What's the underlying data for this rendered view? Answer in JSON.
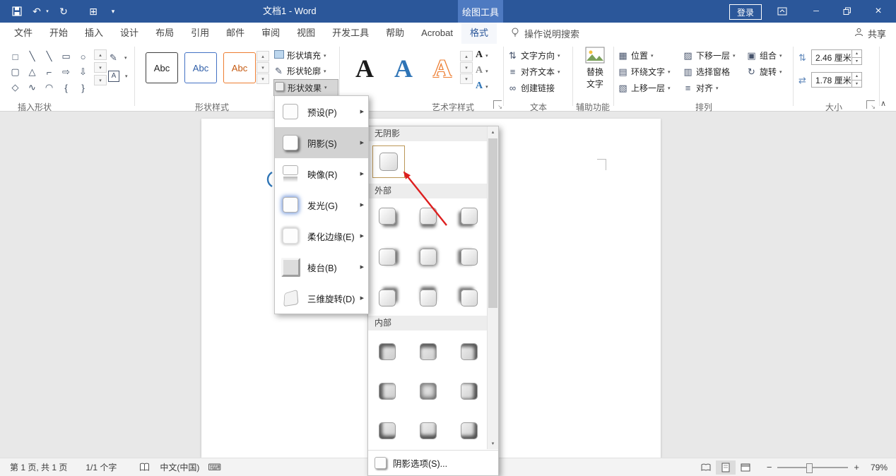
{
  "titlebar": {
    "title": "文档1 - Word",
    "context_tab": "绘图工具",
    "sign_in": "登录"
  },
  "ribbon_tabs": [
    "文件",
    "开始",
    "插入",
    "设计",
    "布局",
    "引用",
    "邮件",
    "审阅",
    "视图",
    "开发工具",
    "帮助",
    "Acrobat",
    "格式"
  ],
  "tellme_label": "操作说明搜索",
  "share_label": "共享",
  "group_labels": {
    "insert_shapes": "插入形状",
    "shape_styles": "形状样式",
    "wordart": "艺术字样式",
    "text": "文本",
    "accessibility": "辅助功能",
    "arrange": "排列",
    "size": "大小"
  },
  "insert_shapes": {
    "shapes": [
      "□",
      "╲",
      "╲",
      "▭",
      "○",
      "▢",
      "△",
      "⌐",
      "⇨",
      "⇩",
      "◇",
      "∿",
      "◠",
      "{",
      "}"
    ],
    "edit_shape": "✎",
    "textbox_letter": "A"
  },
  "shape_styles": {
    "presets": [
      "Abc",
      "Abc",
      "Abc"
    ],
    "fill_label": "形状填充",
    "outline_label": "形状轮廓",
    "effects_label": "形状效果"
  },
  "wordart": {
    "letters": [
      "A",
      "A",
      "A"
    ]
  },
  "text_group": {
    "direction": "文字方向",
    "align_text": "对齐文本",
    "create_link": "创建链接"
  },
  "accessibility": {
    "line1": "替换",
    "line2": "文字"
  },
  "arrange": {
    "position": "位置",
    "wrap_text": "环绕文字",
    "bring_forward": "上移一层",
    "send_backward": "下移一层",
    "selection_pane": "选择窗格",
    "align": "对齐",
    "group": "组合",
    "rotate": "旋转"
  },
  "size": {
    "height_value": "2.46 厘米",
    "width_value": "1.78 厘米"
  },
  "effects_menu": {
    "items": [
      {
        "label": "预设(P)"
      },
      {
        "label": "阴影(S)"
      },
      {
        "label": "映像(R)"
      },
      {
        "label": "发光(G)"
      },
      {
        "label": "柔化边缘(E)"
      },
      {
        "label": "棱台(B)"
      },
      {
        "label": "三维旋转(D)"
      }
    ]
  },
  "shadow_submenu": {
    "no_shadow_header": "无阴影",
    "outer_header": "外部",
    "inner_header": "内部",
    "options_label": "阴影选项(S)..."
  },
  "statusbar": {
    "page_info": "第 1 页, 共 1 页",
    "word_count": "1/1 个字",
    "language": "中文(中国)",
    "zoom_level": "79%"
  },
  "colors": {
    "titlebar": "#2b579a",
    "context_tab": "#4e7ac1",
    "annotation_arrow": "#dd1f1f",
    "abc_border_1": "#3f3f3f",
    "abc_border_2": "#4472c4",
    "abc_border_3": "#ed7d31"
  },
  "icons": {
    "undo": "↶",
    "redo": "↻",
    "touch_mode": "⊞",
    "dropdown": "▾",
    "up": "▴",
    "down": "▾",
    "more": "▾",
    "submenu_arrow": "▶",
    "collapse": "∧",
    "minimize": "─",
    "close": "×",
    "launcher": "↘",
    "height": "⇅",
    "width": "⇄",
    "text_direction": "⇅",
    "align_lines": "≡",
    "link": "∞",
    "pencil": "✎",
    "position": "▦",
    "wrap": "▤",
    "bring_forward": "▧",
    "send_backward": "▨",
    "selection_pane": "▥",
    "align": "≡",
    "group": "▣",
    "rotate": "↻",
    "minus": "−",
    "plus": "+",
    "keyboard": "⌨"
  }
}
